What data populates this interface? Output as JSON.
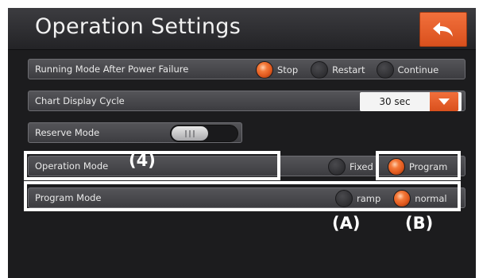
{
  "header": {
    "title": "Operation Settings",
    "back_icon": "back-arrow-icon"
  },
  "rows": {
    "power_failure": {
      "label": "Running Mode After Power Failure",
      "options": [
        "Stop",
        "Restart",
        "Continue"
      ],
      "selected": "Stop"
    },
    "chart_cycle": {
      "label": "Chart Display Cycle",
      "value": "30 sec"
    },
    "reserve": {
      "label": "Reserve Mode",
      "state": "off"
    },
    "operation_mode": {
      "label": "Operation Mode",
      "options": [
        "Fixed",
        "Program"
      ],
      "selected": "Program"
    },
    "program_mode": {
      "label": "Program Mode",
      "options": [
        "ramp",
        "normal"
      ],
      "selected": "normal"
    }
  },
  "annotations": {
    "a": "(A)",
    "b": "(B)",
    "four": "(4)"
  },
  "colors": {
    "accent": "#e35a20",
    "panel": "#1c1c1e",
    "annotation": "#ffffff"
  }
}
